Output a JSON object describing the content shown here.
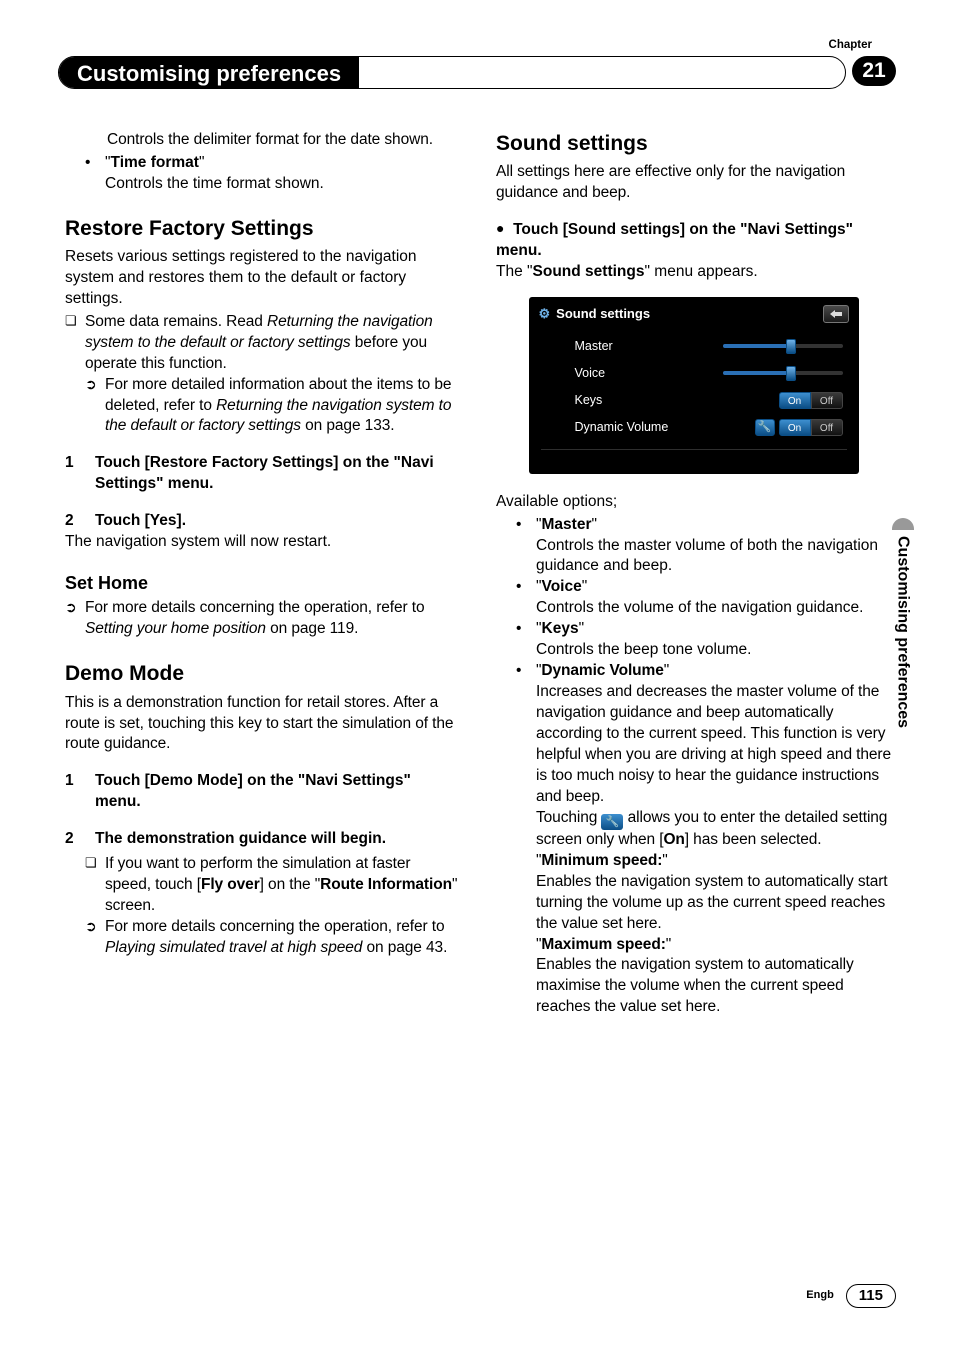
{
  "header": {
    "chapter_label": "Chapter",
    "chapter_number": "21",
    "title": "Customising preferences"
  },
  "side_tab": "Customising preferences",
  "footer": {
    "lang": "Engb",
    "page": "115"
  },
  "col1": {
    "date_delim": "Controls the delimiter format for the date shown.",
    "time_fmt_label": "Time format",
    "time_fmt_desc": "Controls the time format shown.",
    "restore_h": "Restore Factory Settings",
    "restore_p1": "Resets various settings registered to the navigation system and restores them to the default or factory settings.",
    "restore_note_a": "Some data remains. Read ",
    "restore_note_i": "Returning the navigation system to the default or factory settings",
    "restore_note_b": " before you operate this function.",
    "restore_ref_a": "For more detailed information about the items to be deleted, refer to ",
    "restore_ref_i": "Returning the navigation system to the default or factory settings",
    "restore_ref_b": " on page 133.",
    "restore_s1": "Touch [Restore Factory Settings] on the \"Navi Settings\" menu.",
    "restore_s2": "Touch [Yes].",
    "restore_s2_follow": "The navigation system will now restart.",
    "sethome_h": "Set Home",
    "sethome_ref_a": "For more details concerning the operation, refer to ",
    "sethome_ref_i": "Setting your home position",
    "sethome_ref_b": " on page 119.",
    "demo_h": "Demo Mode",
    "demo_p": "This is a demonstration function for retail stores. After a route is set, touching this key to start the simulation of the route guidance.",
    "demo_s1": "Touch [Demo Mode] on the \"Navi Settings\" menu.",
    "demo_s2": "The demonstration guidance will begin.",
    "demo_note_a": "If you want to perform the simulation at faster speed, touch [",
    "demo_note_b": "Fly over",
    "demo_note_c": "] on the \"",
    "demo_note_d": "Route Information",
    "demo_note_e": "\" screen.",
    "demo_ref_a": "For more details concerning the operation, refer to ",
    "demo_ref_i": "Playing simulated travel at high speed",
    "demo_ref_b": " on page 43."
  },
  "col2": {
    "sound_h": "Sound settings",
    "sound_p": "All settings here are effective only for the navigation guidance and beep.",
    "sound_instr": "Touch [Sound settings] on the \"Navi Settings\" menu.",
    "sound_appear_a": "The \"",
    "sound_appear_b": "Sound settings",
    "sound_appear_c": "\" menu appears.",
    "avail": "Available options;",
    "master_l": "Master",
    "master_d": "Controls the master volume of both the navigation guidance and beep.",
    "voice_l": "Voice",
    "voice_d": "Controls the volume of the navigation guidance.",
    "keys_l": "Keys",
    "keys_d": "Controls the beep tone volume.",
    "dyn_l": "Dynamic Volume",
    "dyn_d1": "Increases and decreases the master volume of the navigation guidance and beep automatically according to the current speed. This function is very helpful when you are driving at high speed and there is too much noisy to hear the guidance instructions and beep.",
    "dyn_d2a": "Touching ",
    "dyn_d2b": " allows you to enter the detailed setting screen only when [",
    "dyn_d2c": "On",
    "dyn_d2d": "] has been selected.",
    "min_l": "Minimum speed:",
    "min_d": "Enables the navigation system to automatically start turning the volume up as the current speed reaches the value set here.",
    "max_l": "Maximum speed:",
    "max_d": "Enables the navigation system to automatically maximise the volume when the current speed reaches the value set here."
  },
  "screenshot": {
    "title": "Sound settings",
    "rows": {
      "master": "Master",
      "voice": "Voice",
      "keys": "Keys",
      "dyn": "Dynamic Volume"
    },
    "on": "On",
    "off": "Off"
  }
}
